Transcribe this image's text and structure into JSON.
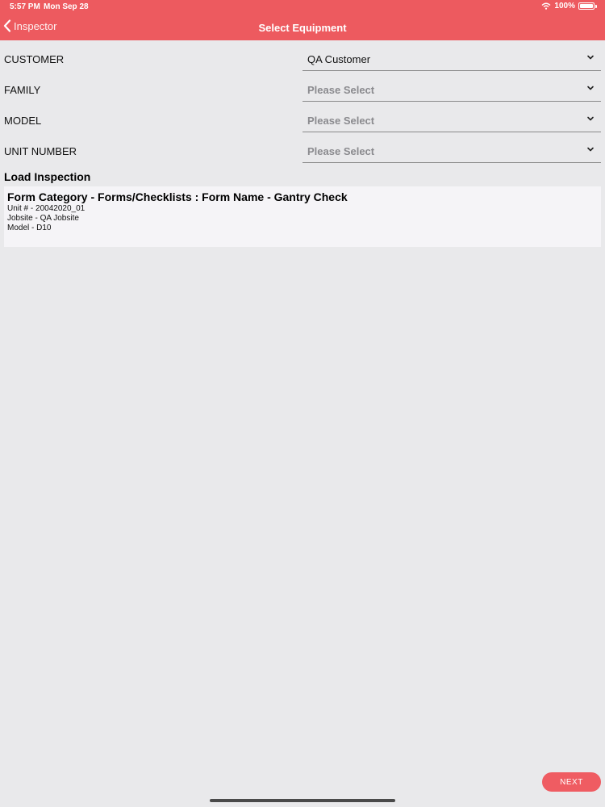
{
  "status_bar": {
    "time": "5:57 PM",
    "date": "Mon Sep 28",
    "battery": "100%"
  },
  "nav": {
    "back_label": "Inspector",
    "title": "Select Equipment"
  },
  "fields": [
    {
      "label": "CUSTOMER",
      "value": "QA Customer",
      "placeholder": false
    },
    {
      "label": "FAMILY",
      "value": "Please Select",
      "placeholder": true
    },
    {
      "label": "MODEL",
      "value": "Please Select",
      "placeholder": true
    },
    {
      "label": "UNIT NUMBER",
      "value": "Please Select",
      "placeholder": true
    }
  ],
  "load_inspection": {
    "title": "Load Inspection",
    "card": {
      "title": "Form Category - Forms/Checklists  : Form Name - Gantry Check",
      "unit": "Unit # - 20042020_01",
      "jobsite": "Jobsite - QA Jobsite",
      "model": "Model - D10"
    }
  },
  "next_label": "NEXT",
  "colors": {
    "accent": "#ed5a5f",
    "background": "#e9e9eb"
  }
}
